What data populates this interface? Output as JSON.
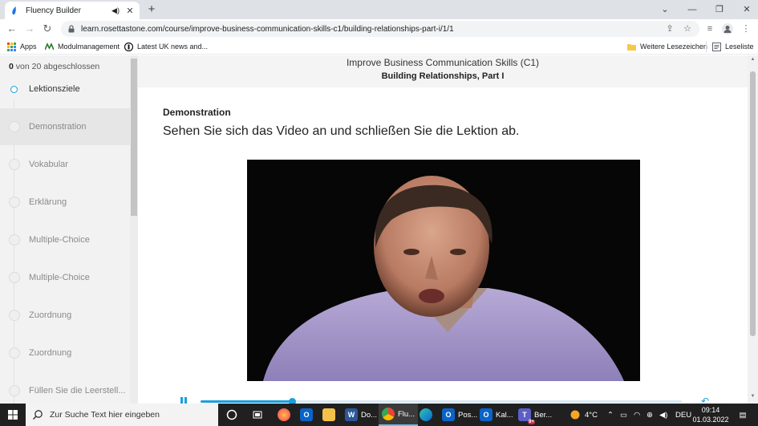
{
  "browser": {
    "tab_title": "Fluency Builder",
    "url": "learn.rosettastone.com/course/improve-business-communication-skills-c1/building-relationships-part-i/1/1",
    "bookmarks": {
      "apps": "Apps",
      "modulmanagement": "Modulmanagement",
      "uk_news": "Latest UK news and...",
      "weitere": "Weitere Lesezeichen",
      "leseliste": "Leseliste"
    }
  },
  "sidebar": {
    "progress_count": "0",
    "progress_suffix": "von 20 abgeschlossen",
    "lessons": [
      {
        "label": "Lektionsziele"
      },
      {
        "label": "Demonstration"
      },
      {
        "label": "Vokabular"
      },
      {
        "label": "Erklärung"
      },
      {
        "label": "Multiple-Choice"
      },
      {
        "label": "Multiple-Choice"
      },
      {
        "label": "Zuordnung"
      },
      {
        "label": "Zuordnung"
      },
      {
        "label": "Füllen Sie die Leerstell..."
      }
    ]
  },
  "main": {
    "course_title": "Improve Business Communication Skills (C1)",
    "unit_title": "Building Relationships, Part I",
    "section_label": "Demonstration",
    "instruction": "Sehen Sie sich das Video an und schließen Sie die Lektion ab.",
    "video_progress": 0.19
  },
  "taskbar": {
    "search_placeholder": "Zur Suche Text hier eingeben",
    "apps": {
      "word": "Do...",
      "chrome": "Flu...",
      "outlook1": "Pos...",
      "outlook2": "Kal...",
      "teams": "Ber..."
    },
    "teams_badge": "9+",
    "weather": "4°C",
    "language": "DEU",
    "time": "09:14",
    "date": "01.03.2022"
  },
  "colors": {
    "accent": "#1a9fdb",
    "sidebar_bg": "#f2f2f2",
    "taskbar_bg": "#202020"
  }
}
